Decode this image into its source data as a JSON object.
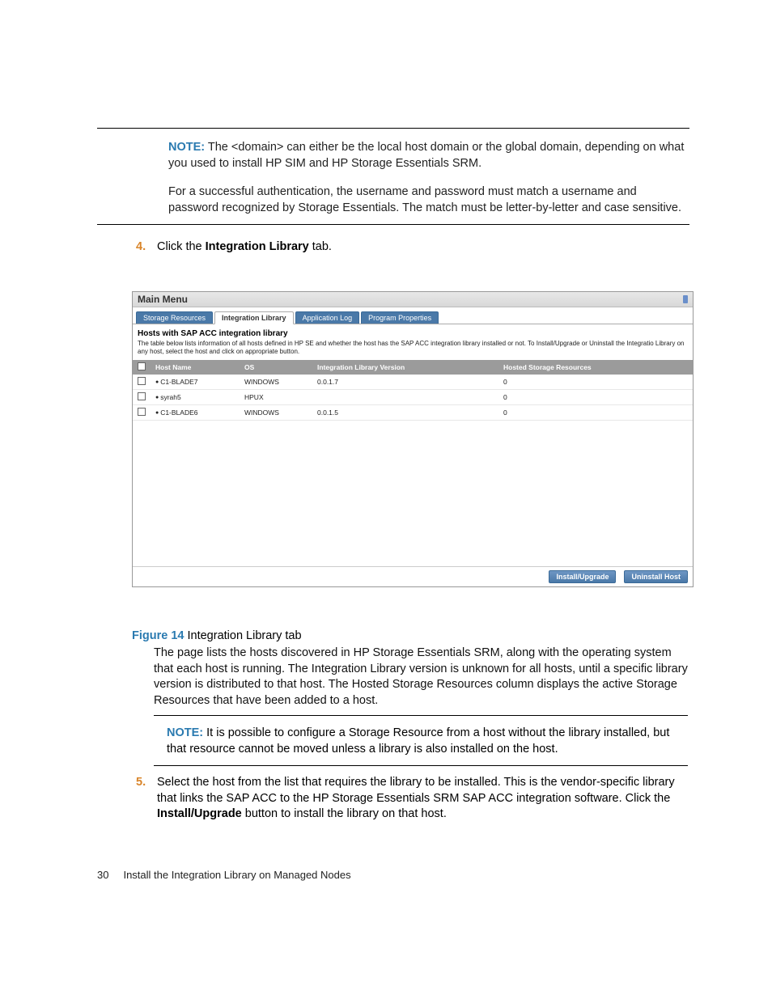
{
  "page_number": "30",
  "footer_text": "Install the Integration Library on Managed Nodes",
  "note1": {
    "label": "NOTE:",
    "para1": "The <domain> can either be the local host domain or the global domain, depending on what you used to install HP SIM and HP Storage Essentials SRM.",
    "para2": "For a successful authentication, the username and password must match a username and password recognized by Storage Essentials. The match must be letter-by-letter and case sensitive."
  },
  "step4": {
    "num": "4.",
    "pre": " Click the ",
    "bold": "Integration Library",
    "post": " tab."
  },
  "screenshot": {
    "title": "Main Menu",
    "tabs": [
      "Storage Resources",
      "Integration Library",
      "Application Log",
      "Program Properties"
    ],
    "active_tab_index": 1,
    "subtitle": "Hosts with SAP ACC integration library",
    "desc": "The table below lists information of all hosts defined in HP SE and whether the host has the SAP ACC integration library installed or not. To Install/Upgrade or Uninstall the Integratio Library on any host, select the host and click on appropriate button.",
    "columns": [
      "",
      "Host Name",
      "OS",
      "Integration Library Version",
      "Hosted Storage Resources"
    ],
    "rows": [
      {
        "host": "C1-BLADE7",
        "os": "WINDOWS",
        "ver": "0.0.1.7",
        "res": "0"
      },
      {
        "host": "syrah5",
        "os": "HPUX",
        "ver": "",
        "res": "0"
      },
      {
        "host": "C1-BLADE6",
        "os": "WINDOWS",
        "ver": "0.0.1.5",
        "res": "0"
      }
    ],
    "buttons": {
      "install": "Install/Upgrade",
      "uninstall": "Uninstall Host"
    }
  },
  "figure": {
    "label": "Figure 14",
    "caption": " Integration Library tab"
  },
  "body_para": "The page lists the hosts discovered in HP Storage Essentials SRM, along with the operating system that each host is running. The Integration Library version is unknown for all hosts, until a specific library version is distributed to that host. The Hosted Storage Resources column displays the active Storage Resources that have been added to a host.",
  "note2": {
    "label": "NOTE:",
    "text": "It is possible to configure a Storage Resource from a host without the library installed, but that resource cannot be moved unless a library is also installed on the host."
  },
  "step5": {
    "num": "5.",
    "pre": " Select the host from the list that requires the library to be installed. This is the vendor-specific library that links the SAP ACC to the HP Storage Essentials SRM SAP ACC integration software. Click the ",
    "bold": "Install/Upgrade",
    "post": " button to install the library on that host."
  }
}
